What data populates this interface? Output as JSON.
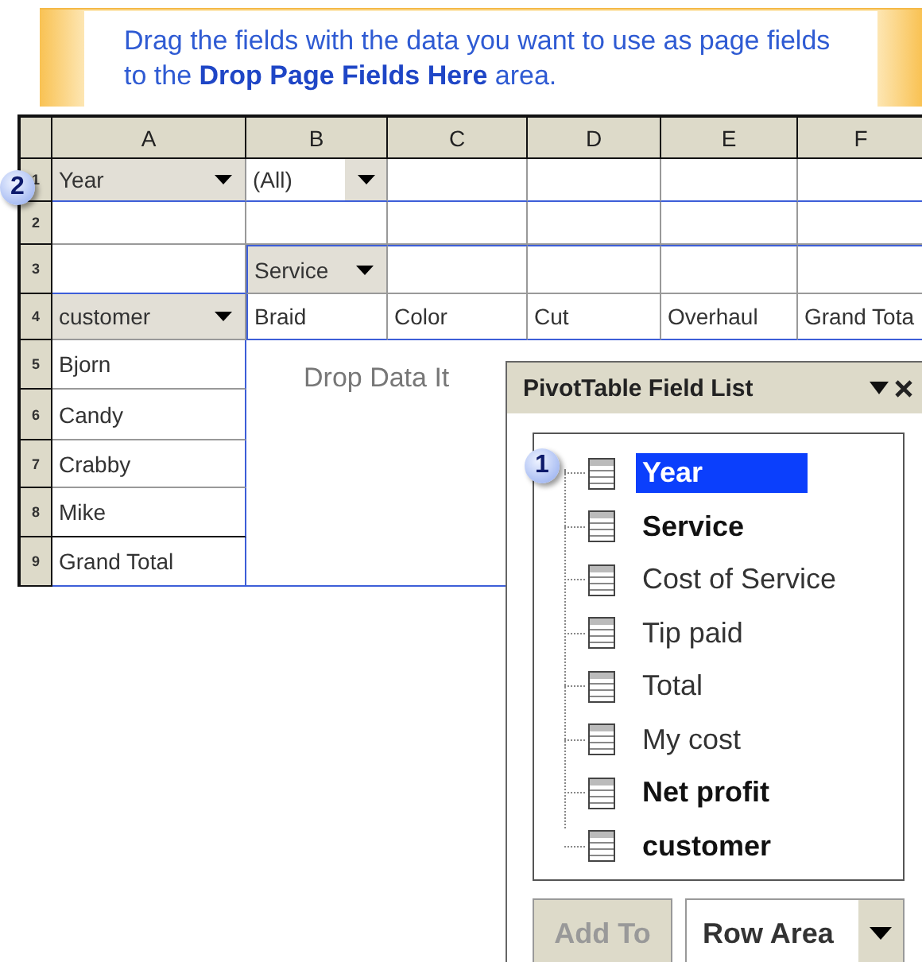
{
  "instruction": "Drag the fields with the data you want to use as page fields to the **Drop Page Fields Here** area.",
  "sheet": {
    "columns": [
      "A",
      "B",
      "C",
      "D",
      "E",
      "F"
    ],
    "rows": [
      {
        "number": "1",
        "cells": [
          {
            "kind": "field",
            "text": "Year"
          },
          {
            "kind": "value",
            "text": "(All)"
          },
          {
            "kind": "empty"
          },
          {
            "kind": "empty"
          },
          {
            "kind": "empty"
          },
          {
            "kind": "empty"
          }
        ]
      },
      {
        "number": "2",
        "cells": [
          {
            "kind": "empty"
          },
          {
            "kind": "empty"
          },
          {
            "kind": "empty"
          },
          {
            "kind": "empty"
          },
          {
            "kind": "empty"
          },
          {
            "kind": "empty"
          }
        ]
      },
      {
        "number": "3",
        "cells": [
          {
            "kind": "empty"
          },
          {
            "kind": "field",
            "text": "Service"
          },
          {
            "kind": "empty"
          },
          {
            "kind": "empty"
          },
          {
            "kind": "empty"
          },
          {
            "kind": "empty"
          }
        ]
      },
      {
        "number": "4",
        "cells": [
          {
            "kind": "field",
            "text": "customer"
          },
          {
            "kind": "text",
            "text": "Braid"
          },
          {
            "kind": "text",
            "text": "Color"
          },
          {
            "kind": "text",
            "text": "Cut"
          },
          {
            "kind": "text",
            "text": "Overhaul"
          },
          {
            "kind": "text",
            "text": "Grand Tota"
          }
        ]
      },
      {
        "number": "5",
        "cells": [
          {
            "kind": "text",
            "text": "Bjorn"
          }
        ]
      },
      {
        "number": "6",
        "cells": [
          {
            "kind": "text",
            "text": "Candy"
          }
        ]
      },
      {
        "number": "7",
        "cells": [
          {
            "kind": "text",
            "text": "Crabby"
          }
        ]
      },
      {
        "number": "8",
        "cells": [
          {
            "kind": "text",
            "text": "Mike"
          }
        ]
      },
      {
        "number": "9",
        "cells": [
          {
            "kind": "text",
            "text": "Grand Total"
          }
        ]
      }
    ],
    "drop_area": "Drop Data It"
  },
  "callouts": [
    {
      "text": "2"
    },
    {
      "text": "1"
    }
  ],
  "field_list": {
    "title": "PivotTable Field List",
    "fields": [
      {
        "name": "Year",
        "in_use": true,
        "selected": true
      },
      {
        "name": "Service",
        "in_use": true,
        "selected": false
      },
      {
        "name": "Cost of Service",
        "in_use": false,
        "selected": false
      },
      {
        "name": "Tip paid",
        "in_use": false,
        "selected": false
      },
      {
        "name": "Total",
        "in_use": false,
        "selected": false
      },
      {
        "name": "My cost",
        "in_use": false,
        "selected": false
      },
      {
        "name": "Net profit",
        "in_use": true,
        "selected": false
      },
      {
        "name": "customer",
        "in_use": true,
        "selected": false
      }
    ],
    "add_button": {
      "label": "Add To",
      "disabled": true
    },
    "area_dropdown": {
      "value": "Row Area"
    }
  }
}
